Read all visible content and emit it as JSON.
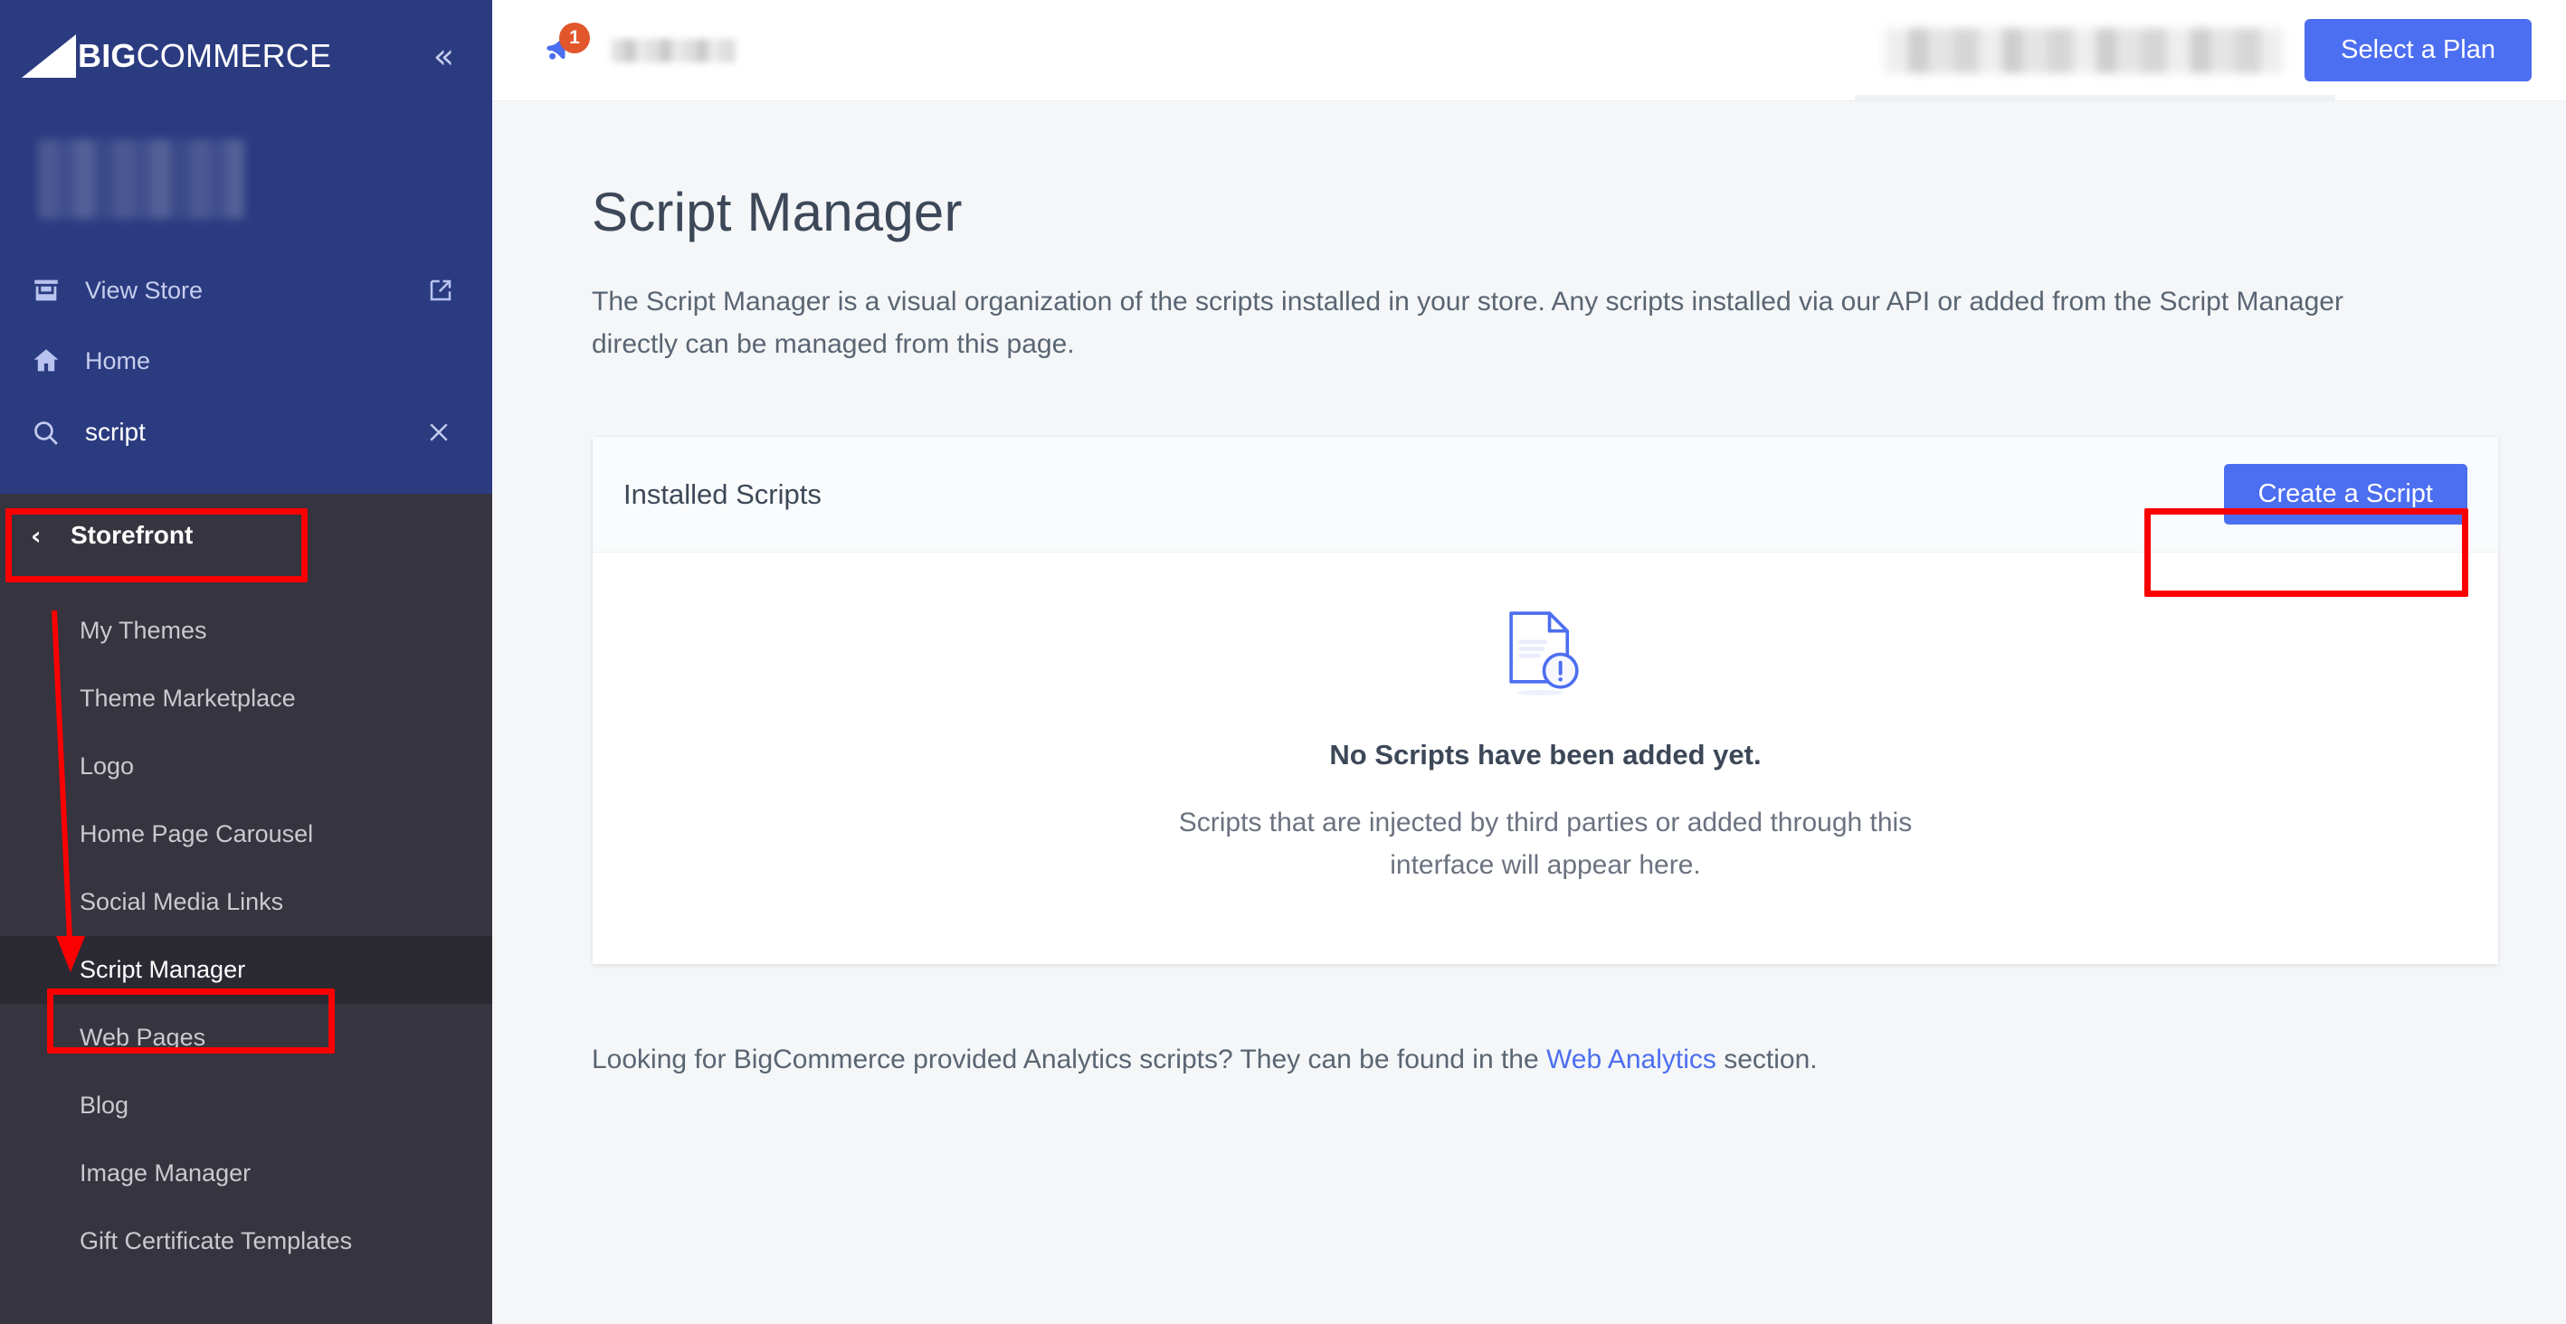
{
  "brand": {
    "name_prefix": "BIG",
    "name_suffix": "COMMERCE",
    "collapse_icon": "chevrons-left-icon"
  },
  "sidebar": {
    "store_name_redacted": "",
    "nav": [
      {
        "label": "View Store",
        "icon": "storefront-icon",
        "trailing_icon": "external-link-icon"
      },
      {
        "label": "Home",
        "icon": "home-icon",
        "trailing_icon": ""
      }
    ],
    "search": {
      "value": "script",
      "placeholder": "Search",
      "icon": "search-icon",
      "clear_icon": "close-icon"
    },
    "submenu": {
      "title": "Storefront",
      "back_icon": "chevron-left-icon",
      "items": [
        {
          "label": "My Themes",
          "active": false
        },
        {
          "label": "Theme Marketplace",
          "active": false
        },
        {
          "label": "Logo",
          "active": false
        },
        {
          "label": "Home Page Carousel",
          "active": false
        },
        {
          "label": "Social Media Links",
          "active": false
        },
        {
          "label": "Script Manager",
          "active": true
        },
        {
          "label": "Web Pages",
          "active": false
        },
        {
          "label": "Blog",
          "active": false
        },
        {
          "label": "Image Manager",
          "active": false
        },
        {
          "label": "Gift Certificate Templates",
          "active": false
        }
      ]
    }
  },
  "topbar": {
    "notification_icon": "megaphone-icon",
    "notification_count": "1",
    "account_redacted": "",
    "plan_button": "Select a Plan"
  },
  "main": {
    "title": "Script Manager",
    "description": "The Script Manager is a visual organization of the scripts installed in your store. Any scripts installed via our API or added from the Script Manager directly can be managed from this page.",
    "card": {
      "header_title": "Installed Scripts",
      "create_button": "Create a Script",
      "empty_icon": "document-alert-icon",
      "empty_title": "No Scripts have been added yet.",
      "empty_subtitle": "Scripts that are injected by third parties or added through this interface will appear here."
    },
    "footer_note": {
      "before": "Looking for BigCommerce provided Analytics scripts? They can be found in the ",
      "link": "Web Analytics",
      "after": " section."
    }
  },
  "annotations": {
    "highlight_color": "#fa0000",
    "boxes": [
      "storefront-menu",
      "script-manager-menu-item",
      "create-a-script-button"
    ],
    "arrow": "red-arrow-pointing-to-script-manager"
  }
}
